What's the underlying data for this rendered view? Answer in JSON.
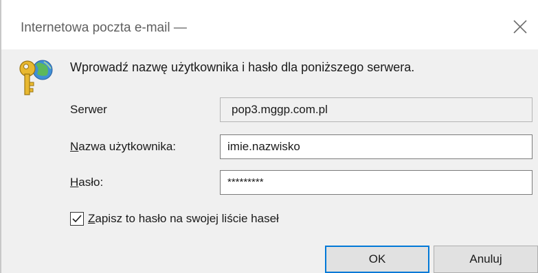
{
  "window": {
    "title": "Internetowa poczta e-mail —"
  },
  "icons": {
    "close": "close-icon",
    "key": "key-globe-icon",
    "checkmark": "checkmark-icon"
  },
  "form": {
    "prompt": "Wprowadź nazwę użytkownika i hasło dla poniższego serwera.",
    "server_label": "Serwer",
    "server_value": "pop3.mggp.com.pl",
    "username_label_accel": "N",
    "username_label_rest": "azwa użytkownika:",
    "username_value": "imie.nazwisko",
    "password_label_accel": "H",
    "password_label_rest": "asło:",
    "password_value": "*********",
    "remember_checked": true,
    "remember_label_accel": "Z",
    "remember_label_rest": "apisz to hasło na swojej liście haseł"
  },
  "buttons": {
    "ok_label": "OK",
    "cancel_label": "Anuluj"
  },
  "colors": {
    "accent": "#0078d7",
    "dialog_bg": "#f0f0f0",
    "button_bg": "#e1e1e1"
  }
}
